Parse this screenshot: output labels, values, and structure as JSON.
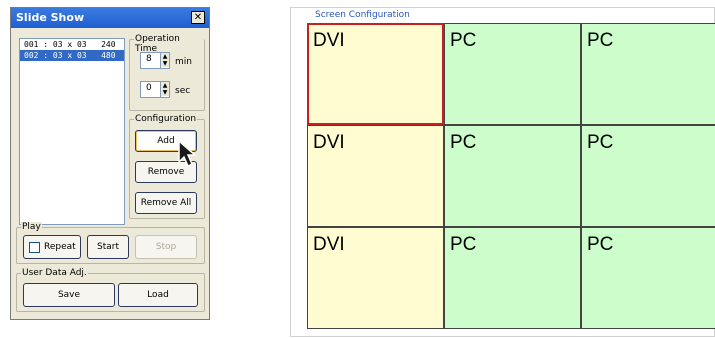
{
  "window": {
    "title": "Slide Show",
    "close_glyph": "✕"
  },
  "slides": [
    {
      "text": "001 : 03 x 03   240",
      "selected": false
    },
    {
      "text": "002 : 03 x 03   480",
      "selected": true
    }
  ],
  "operation_time": {
    "legend": "Operation Time",
    "min_value": "8",
    "min_unit": "min",
    "sec_value": "0",
    "sec_unit": "sec"
  },
  "configuration": {
    "legend": "Configuration",
    "add": "Add",
    "remove": "Remove",
    "remove_all": "Remove All"
  },
  "play": {
    "legend": "Play",
    "repeat_label": "Repeat",
    "repeat_checked": false,
    "start": "Start",
    "stop": "Stop"
  },
  "user_data": {
    "legend": "User Data Adj.",
    "save": "Save",
    "load": "Load"
  },
  "screen_config": {
    "title": "Screen Configuration",
    "cells": [
      {
        "label": "DVI",
        "type": "dvi",
        "selected": true
      },
      {
        "label": "PC",
        "type": "pc",
        "selected": false
      },
      {
        "label": "PC",
        "type": "pc",
        "selected": false
      },
      {
        "label": "DVI",
        "type": "dvi",
        "selected": false
      },
      {
        "label": "PC",
        "type": "pc",
        "selected": false
      },
      {
        "label": "PC",
        "type": "pc",
        "selected": false
      },
      {
        "label": "DVI",
        "type": "dvi",
        "selected": false
      },
      {
        "label": "PC",
        "type": "pc",
        "selected": false
      },
      {
        "label": "PC",
        "type": "pc",
        "selected": false
      }
    ]
  },
  "icons": {
    "cursor": "mouse-pointer-icon",
    "close": "close-icon",
    "spin_up": "▲",
    "spin_down": "▼"
  }
}
